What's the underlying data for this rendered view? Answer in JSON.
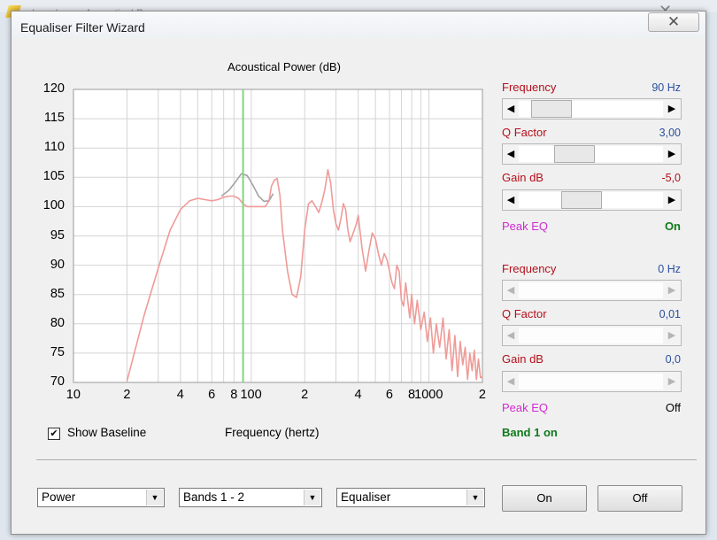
{
  "background_window": {
    "title": "Impulse — Acoustical Power"
  },
  "window": {
    "title": "Equaliser Filter Wizard",
    "close_label": "✕"
  },
  "chart_data": {
    "type": "line",
    "title": "Acoustical Power (dB)",
    "xlabel": "Frequency (hertz)",
    "ylabel": "",
    "x_scale": "log",
    "xlim": [
      10,
      2000
    ],
    "ylim": [
      70,
      120
    ],
    "y_ticks": [
      "120",
      "115",
      "110",
      "105",
      "100",
      "95",
      "90",
      "85",
      "80",
      "75",
      "70"
    ],
    "x_ticks": [
      {
        "v": 10,
        "label": "10"
      },
      {
        "v": 20,
        "label": "2"
      },
      {
        "v": 40,
        "label": "4"
      },
      {
        "v": 60,
        "label": "6"
      },
      {
        "v": 80,
        "label": "8"
      },
      {
        "v": 100,
        "label": "100"
      },
      {
        "v": 200,
        "label": "2"
      },
      {
        "v": 400,
        "label": "4"
      },
      {
        "v": 600,
        "label": "6"
      },
      {
        "v": 800,
        "label": "8"
      },
      {
        "v": 1000,
        "label": "1000"
      },
      {
        "v": 2000,
        "label": "2"
      }
    ],
    "marker_frequency": 90,
    "colors": {
      "baseline": "#a3a3a3",
      "equalised": "#ef9b98",
      "marker": "#7ed67e",
      "grid": "#d4d4d4"
    },
    "series": [
      {
        "role": "baseline",
        "x": [
          68,
          75,
          82,
          88,
          95,
          102,
          110,
          118,
          126,
          133
        ],
        "y": [
          101.8,
          102.8,
          104.3,
          105.6,
          105.3,
          103.7,
          101.8,
          100.9,
          101.0,
          102.2
        ]
      },
      {
        "role": "equalised",
        "x": [
          20,
          25,
          30,
          35,
          40,
          45,
          50,
          55,
          60,
          65,
          70,
          75,
          80,
          85,
          90,
          95,
          100,
          110,
          120,
          126,
          130,
          135,
          140,
          145,
          150,
          160,
          170,
          180,
          190,
          200,
          210,
          220,
          230,
          240,
          250,
          260,
          270,
          280,
          290,
          300,
          310,
          320,
          330,
          340,
          350,
          360,
          370,
          380,
          390,
          400,
          420,
          440,
          460,
          480,
          500,
          520,
          540,
          560,
          580,
          600,
          620,
          640,
          660,
          680,
          700,
          720,
          740,
          760,
          780,
          800,
          830,
          860,
          900,
          940,
          980,
          1020,
          1060,
          1100,
          1150,
          1200,
          1250,
          1300,
          1350,
          1400,
          1450,
          1500,
          1550,
          1600,
          1650,
          1700,
          1750,
          1800,
          1850,
          1900,
          1950,
          2000
        ],
        "y": [
          70.2,
          81.5,
          89.5,
          96,
          99.5,
          101,
          101.4,
          101.2,
          101,
          101.2,
          101.6,
          101.8,
          101.8,
          101.4,
          100.5,
          100,
          100,
          100,
          100,
          101,
          103.5,
          104.5,
          104.8,
          102,
          96,
          89,
          85,
          84.5,
          88,
          96,
          100.5,
          101,
          100,
          99,
          100.8,
          103,
          106.3,
          104,
          99.5,
          97,
          96,
          98,
          100.5,
          99.5,
          96,
          94,
          95,
          96,
          97,
          98.5,
          93,
          89,
          92.5,
          95.5,
          94.5,
          92,
          90,
          92,
          91,
          89,
          87,
          86,
          90,
          89,
          84,
          83,
          87,
          84,
          81,
          85,
          80,
          84,
          79,
          82,
          77,
          81,
          75,
          80,
          76,
          81,
          74,
          79,
          72,
          78,
          71,
          77,
          73,
          76,
          70.5,
          75,
          72,
          75.5,
          70.5,
          74,
          70.8,
          71
        ]
      }
    ]
  },
  "footer": {
    "show_baseline_label": "Show Baseline",
    "show_baseline_checked": true,
    "frequency_axis_label": "Frequency (hertz)"
  },
  "band1": {
    "frequency_label": "Frequency",
    "frequency_value": "90 Hz",
    "frequency_position": 0.12,
    "q_label": "Q Factor",
    "q_value": "3,00",
    "q_position": 0.34,
    "gain_label": "Gain  dB",
    "gain_value": "-5,0",
    "gain_position": 0.41,
    "mode_label": "Peak EQ",
    "state": "On"
  },
  "band2": {
    "frequency_label": "Frequency",
    "frequency_value": "0 Hz",
    "q_label": "Q Factor",
    "q_value": "0,01",
    "gain_label": "Gain  dB",
    "gain_value": "0,0",
    "mode_label": "Peak EQ",
    "state": "Off"
  },
  "band_status": "Band 1 on",
  "bottom": {
    "combo_mode": "Power",
    "combo_bands": "Bands 1 - 2",
    "combo_type": "Equaliser",
    "on_button": "On",
    "off_button": "Off"
  }
}
